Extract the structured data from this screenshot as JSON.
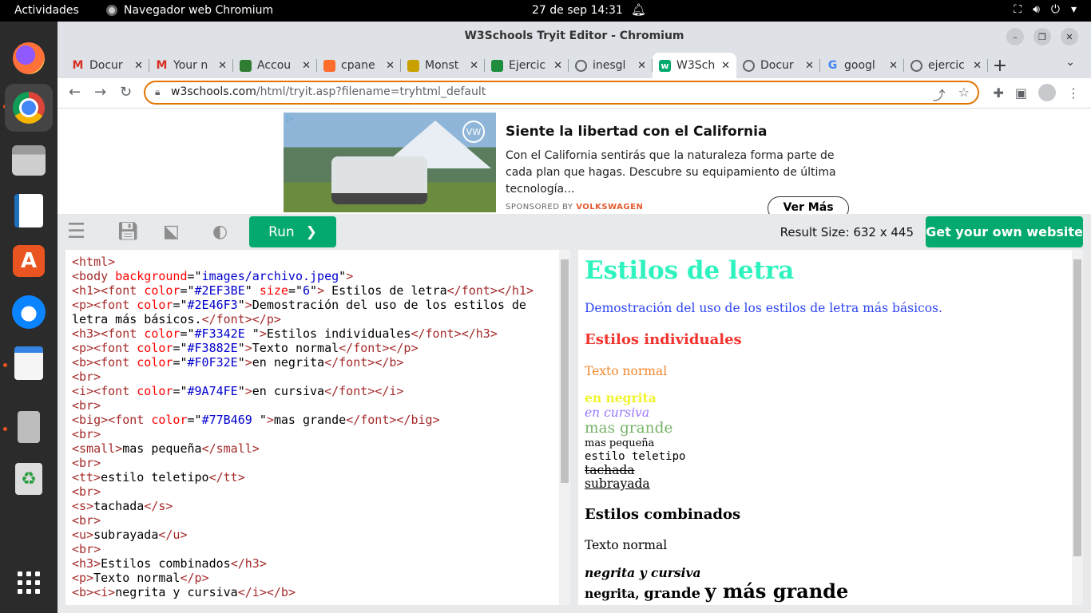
{
  "topbar": {
    "activities": "Actividades",
    "app_name": "Navegador web Chromium",
    "clock": "27 de sep  14:31"
  },
  "window": {
    "title": "W3Schools Tryit Editor - Chromium"
  },
  "tabs": [
    {
      "label": "Docur",
      "favicon": "gmail-icon",
      "color": "#d93025"
    },
    {
      "label": "Your n",
      "favicon": "gmail-icon",
      "color": "#d93025"
    },
    {
      "label": "Accou",
      "favicon": "frog-icon",
      "color": "#2e7d32"
    },
    {
      "label": "cpane",
      "favicon": "cpanel-icon",
      "color": "#ff6c2c"
    },
    {
      "label": "Monst",
      "favicon": "monster-icon",
      "color": "#c8a000"
    },
    {
      "label": "Ejercic",
      "favicon": "classroom-icon",
      "color": "#1e8e3e"
    },
    {
      "label": "inesgl",
      "favicon": "globe-icon",
      "color": "#5f6368"
    },
    {
      "label": "W3Sch",
      "favicon": "w3schools-icon",
      "color": "#04aa6d",
      "active": true
    },
    {
      "label": "Docur",
      "favicon": "globe-icon",
      "color": "#5f6368"
    },
    {
      "label": "googl",
      "favicon": "google-icon",
      "color": "#4285f4"
    },
    {
      "label": "ejercic",
      "favicon": "globe-icon",
      "color": "#5f6368"
    }
  ],
  "address": {
    "host": "w3schools.com",
    "path": "/html/tryit.asp?filename=tryhtml_default"
  },
  "ad": {
    "headline": "Siente la libertad con el California",
    "description": "Con el California sentirás que la naturaleza forma parte de cada plan que hagas. Descubre su equipamiento de última tecnología...",
    "sponsored_prefix": "SPONSORED BY ",
    "sponsor": "VOLKSWAGEN",
    "cta": "Ver Más",
    "logo_text": "VW"
  },
  "tryit": {
    "run_label": "Run",
    "result_size": "Result Size: 632 x 445",
    "get_site": "Get your own website"
  },
  "code_lines": [
    "<html>",
    "<body background=\"images/archivo.jpeg\">",
    "<h1><font color=\"#2EF3BE\" size=\"6\"> Estilos de letra</font></h1>",
    "<p><font color=\"#2E46F3\">Demostración del uso de los estilos de",
    "letra más básicos.</font></p>",
    "<h3><font color=\"#F3342E \">Estilos individuales</font></h3>",
    "<p><font color=\"#F3882E\">Texto normal</font></p>",
    "<b><font color=\"#F0F32E\">en negrita</font></b>",
    "<br>",
    "<i><font color=\"#9A74FE\">en cursiva</font></i>",
    "<br>",
    "<big><font color=\"#77B469 \">mas grande</font></big>",
    "<br>",
    "<small>mas pequeña</small>",
    "<br>",
    "<tt>estilo teletipo</tt>",
    "<br>",
    "<s>tachada</s>",
    "<br>",
    "<u>subrayada</u>",
    "<br>",
    "<h3>Estilos combinados</h3>",
    "<p>Texto normal</p>",
    "<b><i>negrita y cursiva</i></b>"
  ],
  "result": {
    "h1": "Estilos de letra",
    "p_demo": "Demostración del uso de los estilos de letra más básicos.",
    "h3_indiv": "Estilos individuales",
    "texto_normal": "Texto normal",
    "negrita": "en negrita",
    "cursiva": "en cursiva",
    "grande": "mas grande",
    "pequena": "mas pequeña",
    "teletipo": "estilo teletipo",
    "tachada": "tachada",
    "subrayada": "subrayada",
    "h3_comb": "Estilos combinados",
    "texto_normal_2": "Texto normal",
    "negrita_cursiva": "negrita y cursiva",
    "combo_1": "negrita,",
    "combo_2": "grande",
    "combo_3": "y más grande"
  },
  "colors": {
    "h1": "#2EF3BE",
    "demo": "#2E46F3",
    "indiv": "#F3342E",
    "normal": "#F3882E",
    "negrita": "#F0F32E",
    "cursiva": "#9A74FE",
    "grande": "#77B469",
    "w3_green": "#04aa6d",
    "omnibox_focus": "#e37400"
  }
}
